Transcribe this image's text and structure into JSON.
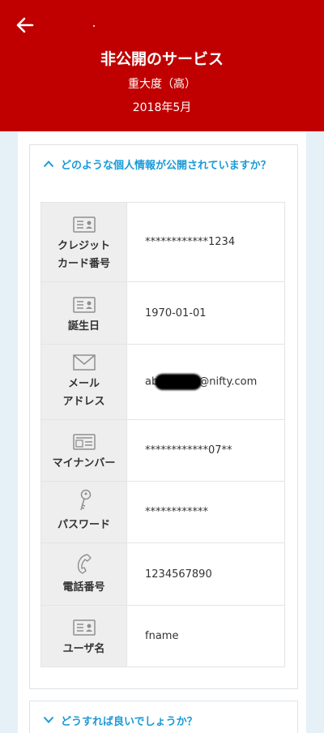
{
  "header": {
    "title": "非公開のサービス",
    "severity": "重大度（高）",
    "date": "2018年5月"
  },
  "accordion1": {
    "question": "どのような個人情報が公開されていますか？",
    "rows": [
      {
        "icon": "id-card-icon",
        "label": "クレジット\nカード番号",
        "value": "************1234"
      },
      {
        "icon": "id-card-icon",
        "label": "誕生日",
        "value": "1970-01-01"
      },
      {
        "icon": "envelope-icon",
        "label": "メール\nアドレス",
        "value_prefix": "ab",
        "value_suffix": "@nifty.com"
      },
      {
        "icon": "mynumber-card-icon",
        "label": "マイナンバー",
        "value": "************07**"
      },
      {
        "icon": "key-icon",
        "label": "パスワード",
        "value": "************"
      },
      {
        "icon": "phone-icon",
        "label": "電話番号",
        "value": "1234567890"
      },
      {
        "icon": "id-card-icon",
        "label": "ユーザ名",
        "value": "fname"
      }
    ]
  },
  "accordion2": {
    "question": "どうすれば良いでしょうか？"
  }
}
